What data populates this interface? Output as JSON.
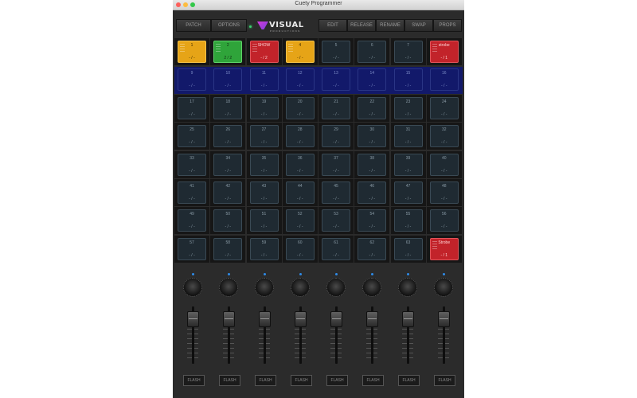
{
  "window": {
    "title": "Cuety Programmer"
  },
  "toolbar": {
    "patch": "PATCH",
    "options": "OPTIONS",
    "edit": "EDIT",
    "release": "RELEASE",
    "rename": "RENAME",
    "swap": "SWAP",
    "props": "PROPS"
  },
  "logo": {
    "text": "VISUAL",
    "sub": "PRODUCTIONS"
  },
  "colors": {
    "yellow": "#e6a417",
    "green": "#2fa43a",
    "red": "#c2232a",
    "blue_row": "#12196a",
    "pad_default": "#1f2a32"
  },
  "pads": [
    {
      "label": "1",
      "level": "- / -",
      "color": "yellow"
    },
    {
      "label": "2",
      "level": "2 / 2",
      "color": "green"
    },
    {
      "label": "SHOW",
      "level": "- / 2",
      "color": "red"
    },
    {
      "label": "4",
      "level": "- / -",
      "color": "yellow"
    },
    {
      "label": "5",
      "level": "- / -",
      "color": "default"
    },
    {
      "label": "6",
      "level": "- / -",
      "color": "default"
    },
    {
      "label": "7",
      "level": "- / -",
      "color": "default"
    },
    {
      "label": "strobe",
      "level": "- / 1",
      "color": "red"
    },
    {
      "label": "9",
      "level": "- / -",
      "color": "blue"
    },
    {
      "label": "10",
      "level": "- / -",
      "color": "blue"
    },
    {
      "label": "11",
      "level": "- / -",
      "color": "blue"
    },
    {
      "label": "12",
      "level": "- / -",
      "color": "blue"
    },
    {
      "label": "13",
      "level": "- / -",
      "color": "blue"
    },
    {
      "label": "14",
      "level": "- / -",
      "color": "blue"
    },
    {
      "label": "15",
      "level": "- / -",
      "color": "blue"
    },
    {
      "label": "16",
      "level": "- / -",
      "color": "blue"
    },
    {
      "label": "17",
      "level": "- / -",
      "color": "default"
    },
    {
      "label": "18",
      "level": "- / -",
      "color": "default"
    },
    {
      "label": "19",
      "level": "- / -",
      "color": "default"
    },
    {
      "label": "20",
      "level": "- / -",
      "color": "default"
    },
    {
      "label": "21",
      "level": "- / -",
      "color": "default"
    },
    {
      "label": "22",
      "level": "- / -",
      "color": "default"
    },
    {
      "label": "23",
      "level": "- / -",
      "color": "default"
    },
    {
      "label": "24",
      "level": "- / -",
      "color": "default"
    },
    {
      "label": "25",
      "level": "- / -",
      "color": "default"
    },
    {
      "label": "26",
      "level": "- / -",
      "color": "default"
    },
    {
      "label": "27",
      "level": "- / -",
      "color": "default"
    },
    {
      "label": "28",
      "level": "- / -",
      "color": "default"
    },
    {
      "label": "29",
      "level": "- / -",
      "color": "default"
    },
    {
      "label": "30",
      "level": "- / -",
      "color": "default"
    },
    {
      "label": "31",
      "level": "- / -",
      "color": "default"
    },
    {
      "label": "32",
      "level": "- / -",
      "color": "default"
    },
    {
      "label": "33",
      "level": "- / -",
      "color": "default"
    },
    {
      "label": "34",
      "level": "- / -",
      "color": "default"
    },
    {
      "label": "35",
      "level": "- / -",
      "color": "default"
    },
    {
      "label": "36",
      "level": "- / -",
      "color": "default"
    },
    {
      "label": "37",
      "level": "- / -",
      "color": "default"
    },
    {
      "label": "38",
      "level": "- / -",
      "color": "default"
    },
    {
      "label": "39",
      "level": "- / -",
      "color": "default"
    },
    {
      "label": "40",
      "level": "- / -",
      "color": "default"
    },
    {
      "label": "41",
      "level": "- / -",
      "color": "default"
    },
    {
      "label": "42",
      "level": "- / -",
      "color": "default"
    },
    {
      "label": "43",
      "level": "- / -",
      "color": "default"
    },
    {
      "label": "44",
      "level": "- / -",
      "color": "default"
    },
    {
      "label": "45",
      "level": "- / -",
      "color": "default"
    },
    {
      "label": "46",
      "level": "- / -",
      "color": "default"
    },
    {
      "label": "47",
      "level": "- / -",
      "color": "default"
    },
    {
      "label": "48",
      "level": "- / -",
      "color": "default"
    },
    {
      "label": "49",
      "level": "- / -",
      "color": "default"
    },
    {
      "label": "50",
      "level": "- / -",
      "color": "default"
    },
    {
      "label": "51",
      "level": "- / -",
      "color": "default"
    },
    {
      "label": "52",
      "level": "- / -",
      "color": "default"
    },
    {
      "label": "53",
      "level": "- / -",
      "color": "default"
    },
    {
      "label": "54",
      "level": "- / -",
      "color": "default"
    },
    {
      "label": "55",
      "level": "- / -",
      "color": "default"
    },
    {
      "label": "56",
      "level": "- / -",
      "color": "default"
    },
    {
      "label": "57",
      "level": "- / -",
      "color": "default"
    },
    {
      "label": "58",
      "level": "- / -",
      "color": "default"
    },
    {
      "label": "59",
      "level": "- / -",
      "color": "default"
    },
    {
      "label": "60",
      "level": "- / -",
      "color": "default"
    },
    {
      "label": "61",
      "level": "- / -",
      "color": "default"
    },
    {
      "label": "62",
      "level": "- / -",
      "color": "default"
    },
    {
      "label": "63",
      "level": "- / -",
      "color": "default"
    },
    {
      "label": "Strobe",
      "level": "- / 1",
      "color": "red"
    }
  ],
  "mixer": {
    "flash_label": "FLASH",
    "channels": 8,
    "fader_levels": [
      0.78,
      0.78,
      0.78,
      0.78,
      0.78,
      0.78,
      0.78,
      0.78
    ]
  }
}
